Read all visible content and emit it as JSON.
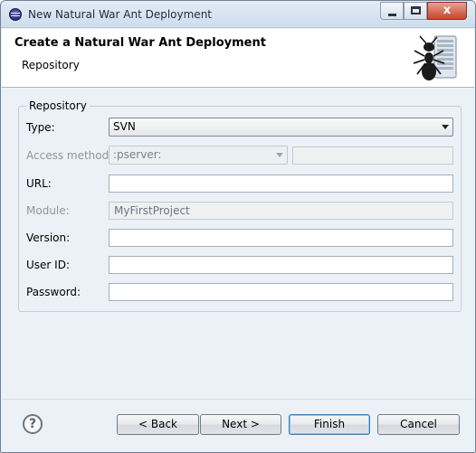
{
  "window": {
    "title": "New Natural War Ant Deployment",
    "icon": "eclipse-app-icon",
    "controls": {
      "minimize": "minimize-icon",
      "maximize": "maximize-icon",
      "close_label": "x"
    }
  },
  "header": {
    "title": "Create a Natural War Ant Deployment",
    "subtitle": "Repository",
    "icon": "ant-server-icon"
  },
  "repository_group": {
    "label": "Repository",
    "type": {
      "label": "Type:",
      "value": "SVN",
      "enabled": true
    },
    "access_method": {
      "label": "Access method:",
      "value": ":pserver:",
      "extra_value": "",
      "enabled": false
    },
    "url": {
      "label": "URL:",
      "value": ""
    },
    "module": {
      "label": "Module:",
      "value": "MyFirstProject",
      "enabled": false
    },
    "version": {
      "label": "Version:",
      "value": ""
    },
    "user_id": {
      "label": "User ID:",
      "value": ""
    },
    "password": {
      "label": "Password:",
      "value": ""
    }
  },
  "footer": {
    "help_label": "?",
    "back_label": "< Back",
    "next_label": "Next >",
    "finish_label": "Finish",
    "cancel_label": "Cancel"
  },
  "colors": {
    "window_bg": "#ecf1f7",
    "header_bg": "#ffffff",
    "default_button_border": "#3c7fb1",
    "disabled_text": "#8e969f"
  }
}
